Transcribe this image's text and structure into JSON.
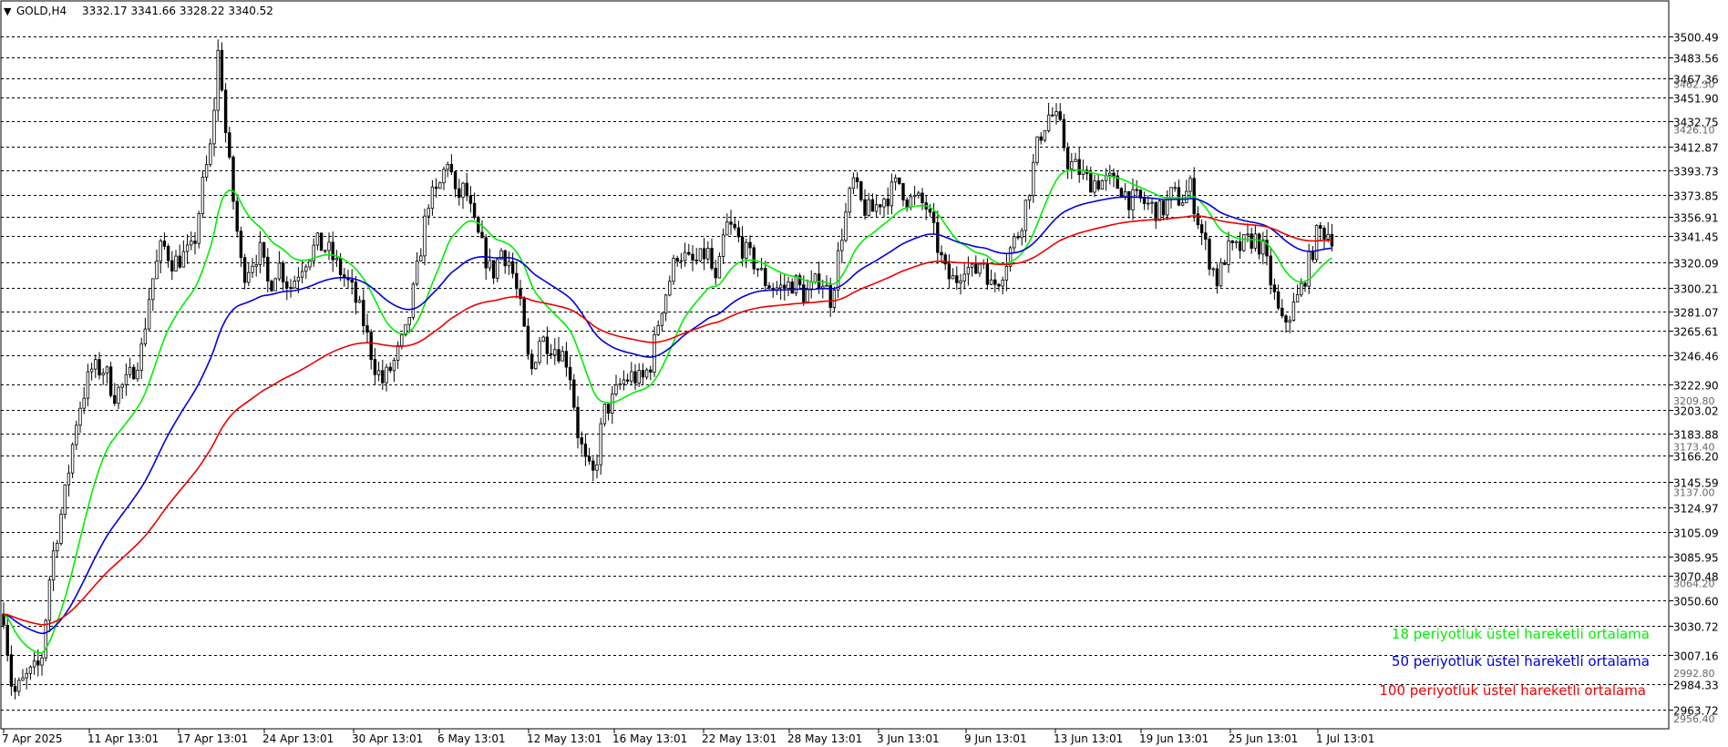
{
  "header": {
    "symbol": "GOLD,H4",
    "ohlc": "3332.17 3341.66 3328.22 3340.52"
  },
  "price_axis": {
    "levels": [
      3500.49,
      3483.56,
      3467.36,
      3451.9,
      3432.75,
      3412.87,
      3393.73,
      3373.85,
      3356.91,
      3341.45,
      3320.09,
      3300.21,
      3281.07,
      3265.61,
      3246.46,
      3222.9,
      3203.02,
      3183.88,
      3166.2,
      3145.59,
      3124.97,
      3105.09,
      3085.95,
      3070.48,
      3050.6,
      3030.72,
      3007.16,
      2984.33,
      2963.72
    ],
    "faint_ticks": [
      "3462.30",
      "3426.10",
      "3209.80",
      "3173.40",
      "3137.00",
      "3064.20",
      "2992.80",
      "2956.40"
    ]
  },
  "time_axis": {
    "labels": [
      "7 Apr 2025",
      "11 Apr 13:01",
      "17 Apr 13:01",
      "24 Apr 13:01",
      "30 Apr 13:01",
      "6 May 13:01",
      "12 May 13:01",
      "16 May 13:01",
      "22 May 13:01",
      "28 May 13:01",
      "3 Jun 13:01",
      "9 Jun 13:01",
      "13 Jun 13:01",
      "19 Jun 13:01",
      "25 Jun 13:01",
      "1 Jul 13:01"
    ]
  },
  "legend": {
    "ema18": "18 periyotluk üstel hareketli ortalama",
    "ema50": "50 periyotluk üstel hareketli ortalama",
    "ema100": "100 periyotluk üstel hareketli ortalama"
  },
  "colors": {
    "ema18": "#00ee00",
    "ema50": "#0000dd",
    "ema100": "#ee0000",
    "candle": "#000000",
    "grid": "#000000"
  },
  "chart_data": {
    "type": "line",
    "x": [
      "7 Apr 2025",
      "11 Apr 13:01",
      "17 Apr 13:01",
      "24 Apr 13:01",
      "30 Apr 13:01",
      "6 May 13:01",
      "12 May 13:01",
      "16 May 13:01",
      "22 May 13:01",
      "28 May 13:01",
      "3 Jun 13:01",
      "9 Jun 13:01",
      "13 Jun 13:01",
      "19 Jun 13:01",
      "25 Jun 13:01",
      "1 Jul 13:01"
    ],
    "ylim": [
      2950,
      3520
    ],
    "price_close": [
      3020,
      3200,
      3340,
      3300,
      3250,
      3380,
      3290,
      3220,
      3340,
      3310,
      3380,
      3320,
      3410,
      3370,
      3270,
      3340.52
    ],
    "series": [
      {
        "name": "18 periyotluk üstel hareketli ortalama",
        "values": [
          3060,
          3140,
          3340,
          3340,
          3290,
          3380,
          3290,
          3240,
          3310,
          3300,
          3360,
          3330,
          3390,
          3370,
          3300,
          3330
        ]
      },
      {
        "name": "50 periyotluk üstel hareketli ortalama",
        "values": [
          3070,
          3110,
          3260,
          3305,
          3275,
          3330,
          3310,
          3250,
          3280,
          3295,
          3340,
          3340,
          3370,
          3375,
          3350,
          3335
        ]
      },
      {
        "name": "100 periyotluk üstel hareketli ortalama",
        "values": [
          3050,
          3090,
          3190,
          3240,
          3255,
          3295,
          3285,
          3255,
          3270,
          3285,
          3310,
          3315,
          3345,
          3355,
          3350,
          3340
        ]
      }
    ]
  }
}
